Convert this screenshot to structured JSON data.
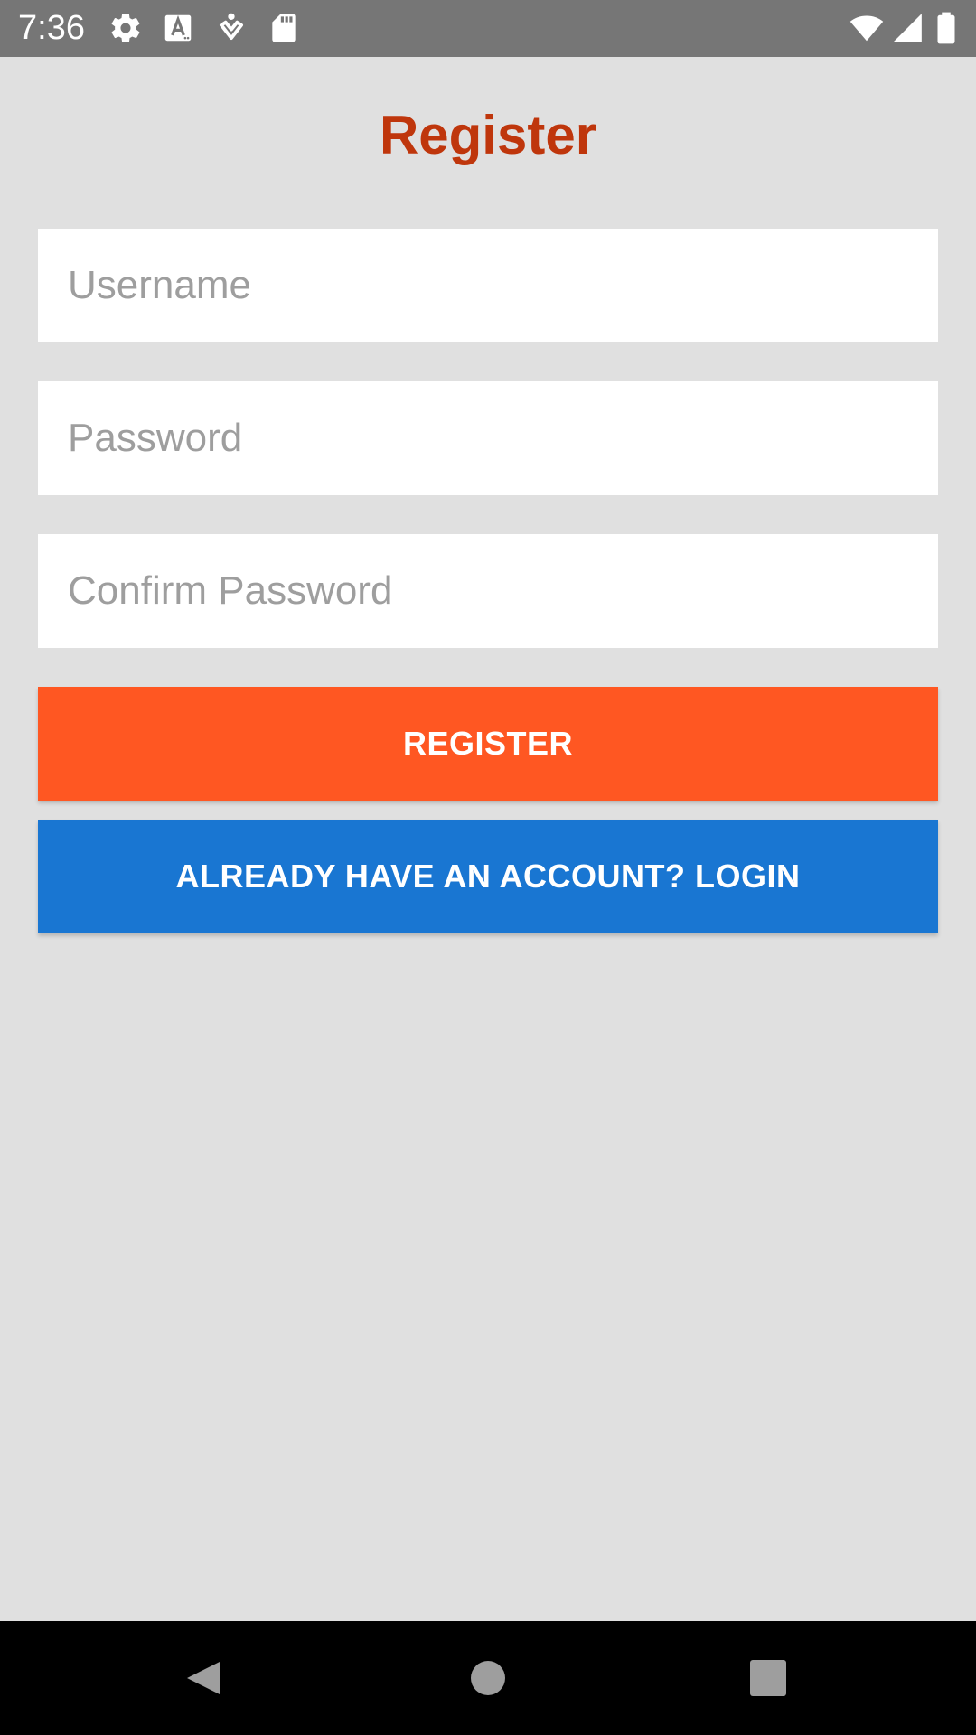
{
  "status_bar": {
    "time": "7:36",
    "icons": [
      "settings-icon",
      "keyboard-a-icon",
      "accessibility-icon",
      "sd-card-icon",
      "wifi-icon",
      "cell-signal-icon",
      "battery-icon"
    ]
  },
  "header": {
    "title": "Register"
  },
  "form": {
    "username_placeholder": "Username",
    "password_placeholder": "Password",
    "confirm_password_placeholder": "Confirm Password",
    "register_label": "REGISTER",
    "login_label": "ALREADY HAVE AN ACCOUNT? LOGIN"
  },
  "nav_bar": {
    "icons": [
      "back-icon",
      "home-icon",
      "recents-icon"
    ]
  },
  "colors": {
    "title": "#bf360c",
    "register_button": "#ff5722",
    "login_button": "#1976d2",
    "background": "#e0e0e0",
    "status_bar": "#767676"
  }
}
